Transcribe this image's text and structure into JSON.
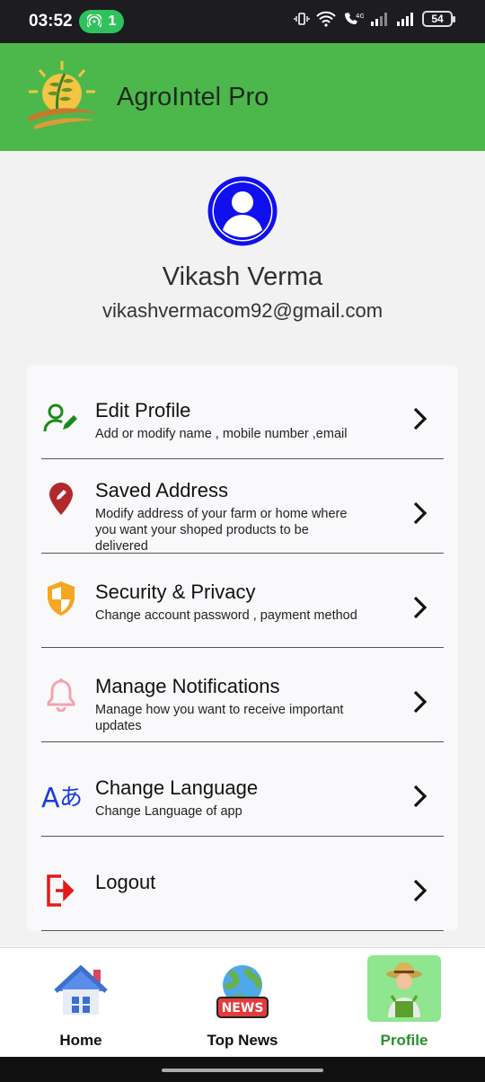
{
  "status_bar": {
    "time": "03:52",
    "hotspot_count": "1",
    "battery": "54"
  },
  "app": {
    "title": "AgroIntel Pro"
  },
  "profile": {
    "name": "Vikash Verma",
    "email": "vikashvermacom92@gmail.com"
  },
  "settings": {
    "items": [
      {
        "title": "Edit Profile",
        "desc": "Add or modify name , mobile number ,email",
        "icon": "edit-person-icon",
        "color": "#1a8a1a"
      },
      {
        "title": "Saved Address",
        "desc": "Modify address of your farm or home where you want your shoped products to be delivered",
        "icon": "location-pin-icon",
        "color": "#b3282d"
      },
      {
        "title": "Security & Privacy",
        "desc": "Change account password , payment method",
        "icon": "shield-icon",
        "color": "#f5a623"
      },
      {
        "title": "Manage Notifications",
        "desc": "Manage how you want to receive important updates",
        "icon": "bell-icon",
        "color": "#f4a3ad"
      },
      {
        "title": "Change Language",
        "desc": "Change Language of app",
        "icon": "translate-icon",
        "color": "#1a3be0"
      },
      {
        "title": "Logout",
        "desc": "",
        "icon": "logout-icon",
        "color": "#e21b1b"
      }
    ]
  },
  "bottom_nav": {
    "items": [
      {
        "label": "Home",
        "icon": "home-icon"
      },
      {
        "label": "Top News",
        "icon": "news-globe-icon"
      },
      {
        "label": "Profile",
        "icon": "farmer-icon",
        "active": true
      }
    ]
  }
}
